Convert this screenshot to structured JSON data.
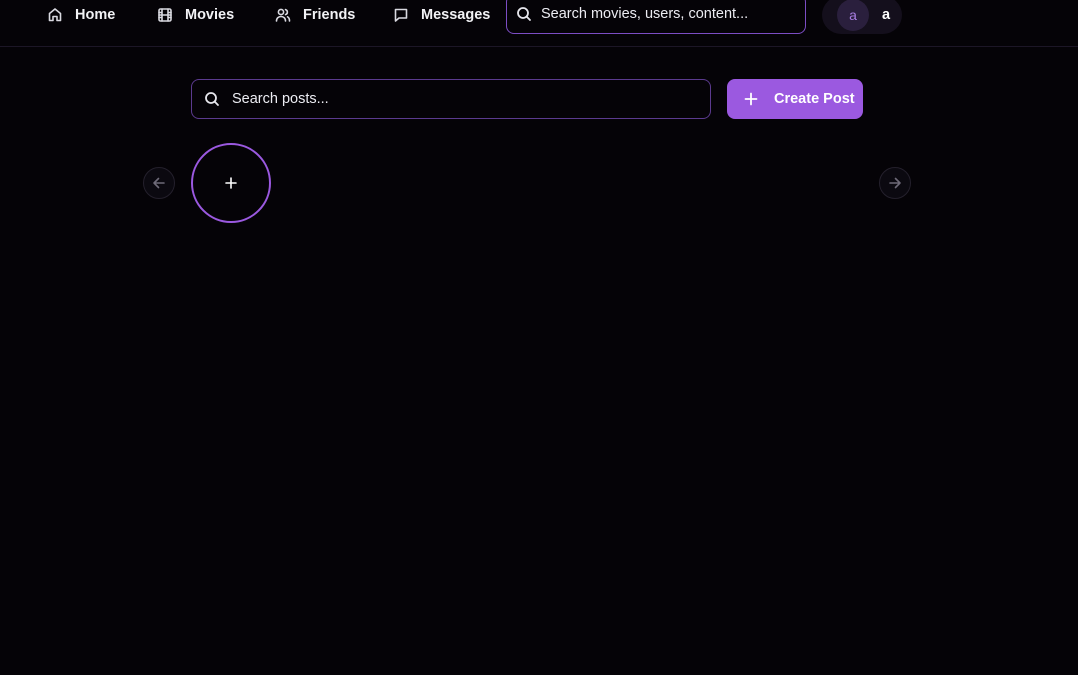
{
  "nav": {
    "items": [
      {
        "label": "Home",
        "icon": "home-icon"
      },
      {
        "label": "Movies",
        "icon": "film-icon"
      },
      {
        "label": "Friends",
        "icon": "users-icon"
      },
      {
        "label": "Messages",
        "icon": "message-icon"
      }
    ],
    "search": {
      "placeholder": "Search movies, users, content..."
    },
    "user": {
      "avatar_letter": "a",
      "name": "a"
    }
  },
  "feed": {
    "search": {
      "placeholder": "Search posts..."
    },
    "create_post_label": "Create Post"
  },
  "colors": {
    "background": "#050307",
    "accent": "#9b59e0",
    "border_accent": "#7c4dc4"
  }
}
